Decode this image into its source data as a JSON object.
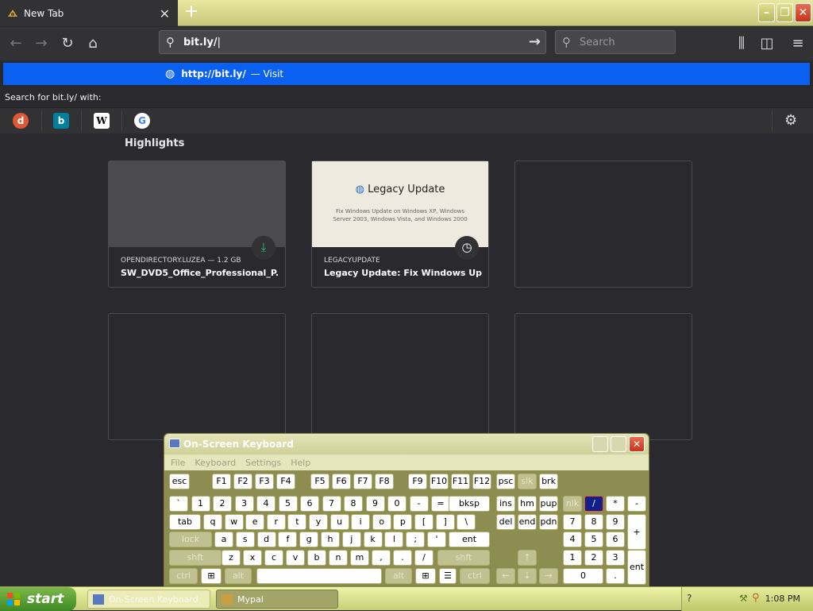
{
  "tab": {
    "title": "New Tab"
  },
  "nav": {
    "url": "bit.ly/",
    "search_placeholder": "Search"
  },
  "popup": {
    "suggestion_url": "http://bit.ly/",
    "suggestion_action": "— Visit",
    "search_with": "Search for bit.ly/ with:",
    "engines": [
      "DuckDuckGo",
      "Bing",
      "Wikipedia",
      "Google"
    ]
  },
  "highlights": {
    "heading": "Highlights",
    "cards": [
      {
        "source": "OPENDIRECTORY.LUZEA — 1.2 GB",
        "title": "SW_DVD5_Office_Professional_P...",
        "badge": "download-icon"
      },
      {
        "source": "LEGACYUPDATE",
        "title": "Legacy Update: Fix Windows Up...",
        "thumb_title": "Legacy Update",
        "thumb_text": "Fix Windows Update on Windows XP, Windows Server 2003, Windows Vista, and Windows 2000",
        "badge": "clock-icon"
      }
    ]
  },
  "osk": {
    "title": "On-Screen Keyboard",
    "menu": [
      "File",
      "Keyboard",
      "Settings",
      "Help"
    ]
  },
  "taskbar": {
    "start": "start",
    "tasks": [
      "On-Screen Keyboard",
      "Mypal"
    ],
    "clock": "1:08 PM"
  },
  "colors": {
    "accent": "#0a60f0",
    "toolbar": "#323234",
    "content_bg": "#2a2a2e"
  }
}
